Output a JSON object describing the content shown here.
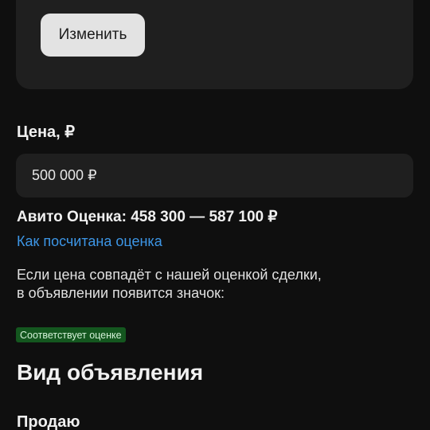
{
  "edit_card": {
    "change_button_label": "Изменить"
  },
  "price": {
    "heading": "Цена, ₽",
    "input_value": "500 000 ₽"
  },
  "estimate": {
    "text": "Авито Оценка: 458 300 — 587 100 ₽",
    "link_label": "Как посчитана оценка",
    "info_line1": "Если цена совпадёт с нашей оценкой сделки,",
    "info_line2": "в объявлении появится значок:",
    "badge_label": "Соответствует оценке"
  },
  "listing_type": {
    "heading": "Вид объявления",
    "option_label": "Продаю"
  },
  "colors": {
    "background": "#0f0f0f",
    "card": "#1f1f1f",
    "link": "#3d96e6",
    "badge_bg": "#14571f",
    "button_bg": "#e3e3e3"
  }
}
